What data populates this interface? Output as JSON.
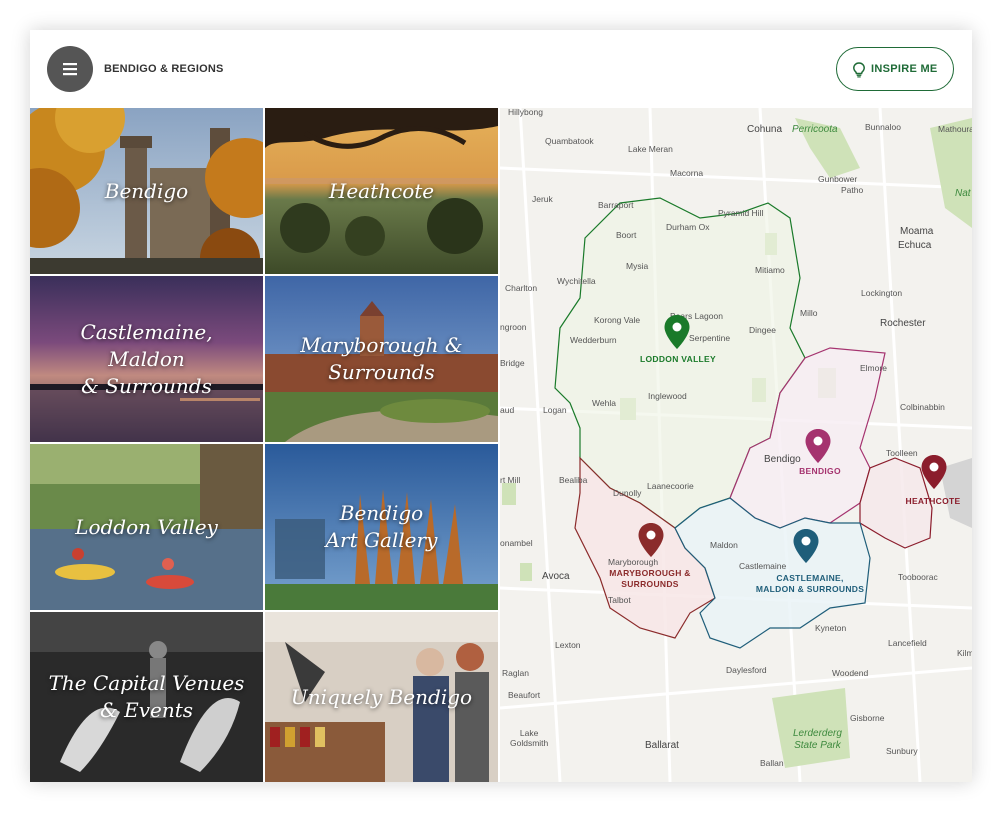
{
  "header": {
    "brand": "BENDIGO & REGIONS",
    "inspire_label": "INSPIRE ME"
  },
  "icons": {
    "menu": "hamburger-menu-icon",
    "inspire": "lightbulb-icon",
    "pin": "map-pin-icon"
  },
  "tiles": [
    {
      "label": "Bendigo",
      "photo": "autumn trees and clock tower"
    },
    {
      "label": "Heathcote",
      "photo": "sunset through tree branches"
    },
    {
      "label": "Castlemaine, Maldon\n& Surrounds",
      "photo": "purple dusk over lake"
    },
    {
      "label": "Maryborough &\nSurrounds",
      "photo": "historic railway station"
    },
    {
      "label": "Loddon Valley",
      "photo": "kayakers on river"
    },
    {
      "label": "Bendigo\nArt Gallery",
      "photo": "gallery building at dusk"
    },
    {
      "label": "The Capital Venues\n& Events",
      "photo": "dancer black and white"
    },
    {
      "label": "Uniquely Bendigo",
      "photo": "couple shopping in store"
    }
  ],
  "map": {
    "regions": [
      {
        "name": "LODDON VALLEY",
        "color": "#1a7a2a"
      },
      {
        "name": "BENDIGO",
        "color": "#a5336f"
      },
      {
        "name": "HEATHCOTE",
        "color": "#8b1d2c"
      },
      {
        "name": "MARYBOROUGH &\nSURROUNDS",
        "color": "#8b2b2b"
      },
      {
        "name": "CASTLEMAINE,\nMALDON & SURROUNDS",
        "color": "#1f5e7a"
      }
    ],
    "towns": [
      "Hillybong",
      "Quambatook",
      "Lake Meran",
      "Cohuna",
      "Perricoota",
      "Bunnaloo",
      "Mathoura",
      "Macorna",
      "Gunbower",
      "Patho",
      "Nat",
      "Jeruk",
      "Barraport",
      "Pyramid Hill",
      "Boort",
      "Durham Ox",
      "Moama",
      "Echuca",
      "Wychitella",
      "Mysia",
      "Mitiamo",
      "Charlton",
      "Lockington",
      "Korong Vale",
      "Bears Lagoon",
      "Serpentine",
      "Millo",
      "Rochester",
      "ngroon",
      "Wedderburn",
      "Dingee",
      "Boort",
      "Elmore",
      "Bridge",
      "Inglewood",
      "aud",
      "Logan",
      "Wehla",
      "Colbinabbin",
      "Bendigo",
      "Toolleen",
      "rt Mill",
      "Bealiba",
      "Dunolly",
      "Laanecoorie",
      "onambel",
      "Maldon",
      "Castlemaine",
      "Tooboorac",
      "Avoca",
      "Maryborough",
      "Talbot",
      "Kyneton",
      "Lancefield",
      "Kilm",
      "Lexton",
      "Raglan",
      "Daylesford",
      "Woodend",
      "Beaufort",
      "Gisborne",
      "Lake\nGoldsmith",
      "Ballarat",
      "Sunbury",
      "Ballan"
    ],
    "parks": [
      "Lerderderg\nState Park"
    ]
  }
}
